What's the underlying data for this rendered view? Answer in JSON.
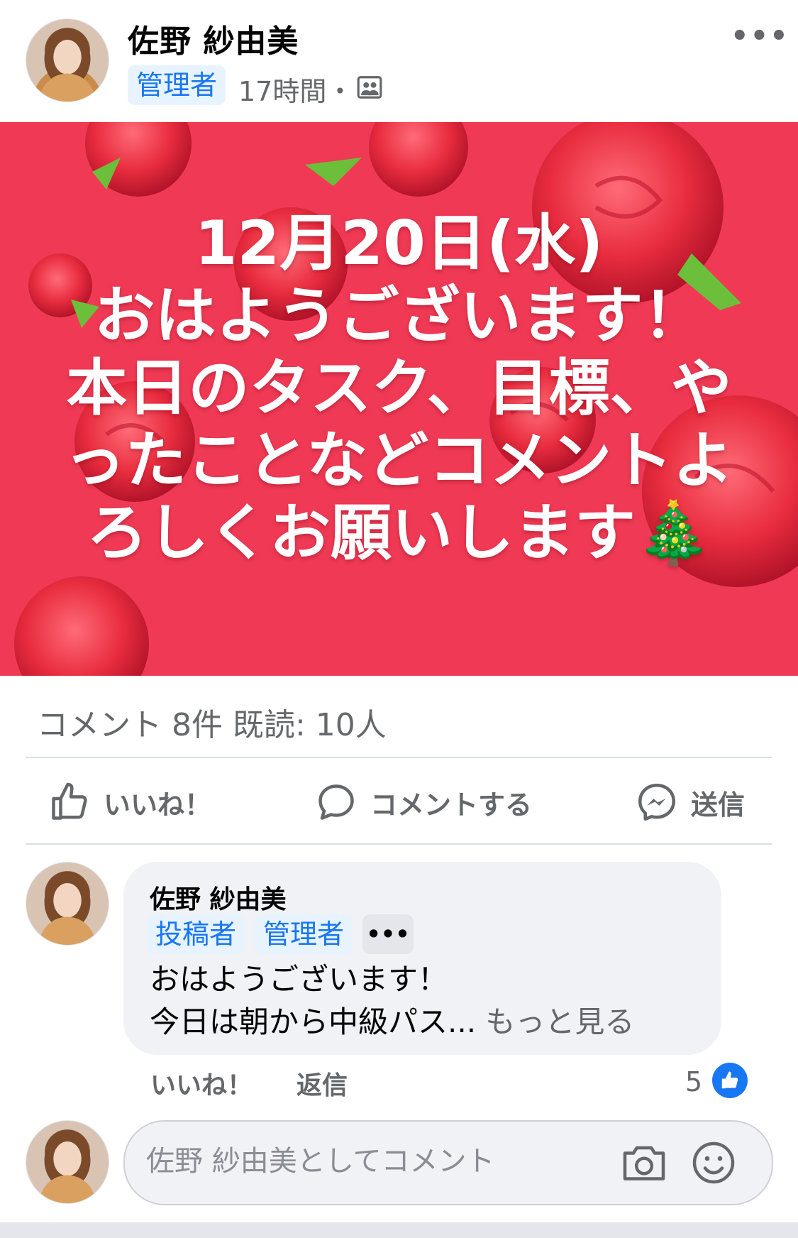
{
  "post": {
    "author_name": "佐野 紗由美",
    "author_badge": "管理者",
    "time": "17時間・",
    "more_label": "•••",
    "banner_lines": [
      "12月20日(水)",
      "おはようございます！",
      "本日のタスク、目標、や",
      "ったことなどコメントよ",
      "ろしくお願いします🎄"
    ],
    "stats": "コメント 8件  既読: 10人"
  },
  "actions": {
    "like": "いいね！",
    "comment": "コメントする",
    "send": "送信"
  },
  "comment": {
    "author_name": "佐野 紗由美",
    "badges": [
      "投稿者",
      "管理者"
    ],
    "badge_more": "•••",
    "text_line1": "おはようございます！",
    "text_line2": "今日は朝から中級パス...",
    "see_more": "もっと見る",
    "like_label": "いいね！",
    "reply_label": "返信",
    "reaction_count": "5"
  },
  "composer": {
    "placeholder": "佐野 紗由美としてコメント"
  },
  "colors": {
    "accent": "#1877f2",
    "banner": "#f03a55",
    "secondary_text": "#65676b"
  },
  "icons": [
    "group-privacy-icon",
    "like-icon",
    "comment-icon",
    "messenger-icon",
    "like-reaction-icon",
    "camera-icon",
    "emoji-icon"
  ]
}
